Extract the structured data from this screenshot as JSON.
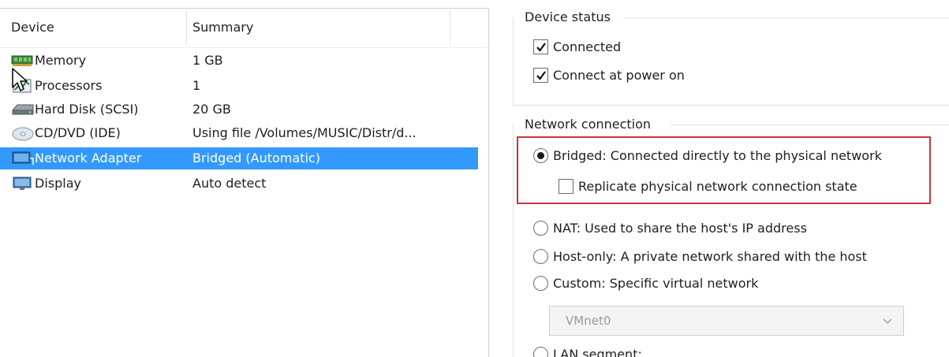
{
  "device_list": {
    "columns": {
      "device": "Device",
      "summary": "Summary"
    },
    "rows": [
      {
        "name": "Memory",
        "summary": "1 GB",
        "icon": "memory-icon",
        "selected": false
      },
      {
        "name": "Processors",
        "summary": "1",
        "icon": "processor-icon",
        "selected": false
      },
      {
        "name": "Hard Disk (SCSI)",
        "summary": "20 GB",
        "icon": "hard-disk-icon",
        "selected": false
      },
      {
        "name": "CD/DVD (IDE)",
        "summary": "Using file /Volumes/MUSIC/Distr/d...",
        "icon": "cd-dvd-icon",
        "selected": false
      },
      {
        "name": "Network Adapter",
        "summary": "Bridged (Automatic)",
        "icon": "network-adapter-icon",
        "selected": true
      },
      {
        "name": "Display",
        "summary": "Auto detect",
        "icon": "display-icon",
        "selected": false
      }
    ]
  },
  "device_status": {
    "title": "Device status",
    "connected": {
      "label": "Connected",
      "checked": true
    },
    "connect_at_power_on": {
      "label": "Connect at power on",
      "checked": true
    }
  },
  "network_connection": {
    "title": "Network connection",
    "bridged": {
      "label": "Bridged: Connected directly to the physical network",
      "selected": true
    },
    "replicate": {
      "label": "Replicate physical network connection state",
      "checked": false
    },
    "nat": {
      "label": "NAT: Used to share the host's IP address",
      "selected": false
    },
    "host_only": {
      "label": "Host-only: A private network shared with the host",
      "selected": false
    },
    "custom": {
      "label": "Custom: Specific virtual network",
      "selected": false
    },
    "custom_network_value": "VMnet0",
    "lan_segment": {
      "label": "LAN segment:",
      "selected": false
    }
  },
  "colors": {
    "selection": "#3399ff",
    "highlight_border": "#c9353d"
  }
}
